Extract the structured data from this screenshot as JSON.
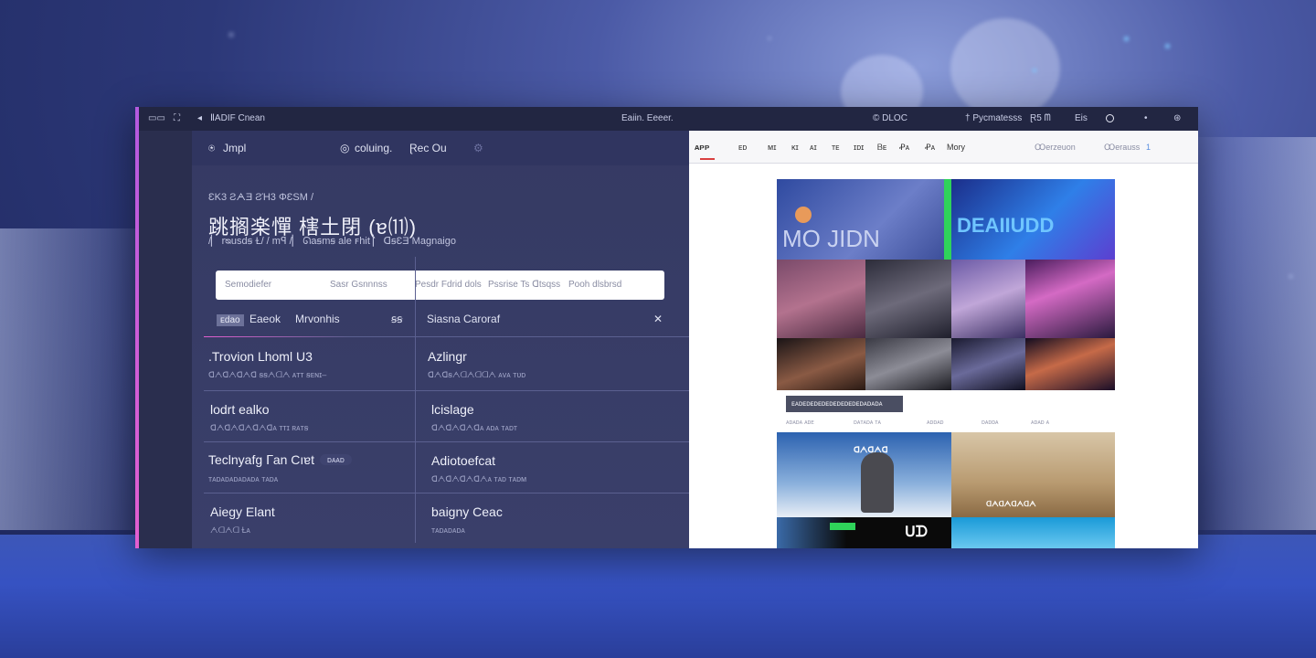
{
  "window": {
    "title": "ⅡADIF Cnean",
    "center_title": "Eaiin. Eeeer.",
    "status_right": [
      "© DLOC",
      "† Pycmatesss",
      "Ɽ5 ᗰ",
      "Eis"
    ]
  },
  "subbar": {
    "brand": "Jmpl",
    "search_label": "coluing.",
    "action": "Ɽec Ou"
  },
  "hero": {
    "breadcrumb": "ƐK3 ƧᗅƎ ƧΉ3 ΦƐSM /",
    "title": "跳搁楽憚 㮫土閉 (ɐ⑾)",
    "subtitle": "/▏ rᴓusdꞩ Ɫ/ /  mꟼ /▏ ᘏaꞩmꞩ ale ꜰhit ▏ ᗡꞩƐƎ Magnaigo"
  },
  "search": {
    "placeholder": "Semodiefer",
    "hints": [
      "Sasr Gsnnnss",
      "Pesdr Fdrid dols",
      "Pssrise Ts ᗡtsqss",
      "Pooh dlsbrsd"
    ]
  },
  "filters": {
    "chip": "ᴇdao",
    "left_a": "Eaeok",
    "left_b": "Mrvonhis",
    "left_x": "ꞩꞩ",
    "right_a": "Siasna Caroraf",
    "right_x": "✕"
  },
  "rows": [
    {
      "left_title": ".Trovion Lhoml U3",
      "left_sub": "ᗡᗅᗡᗅᗡᗅᗡ ꞩꞩᗅᗡᗅ  ᴀᴛᴛ  ꞩᴇɴɪ–",
      "right_title": "Azlingr",
      "right_sub": "ᗡᗅᗡꞩᗅᗡᗅᗡᗡᗅ  ᴀᴠᴀ  ᴛᴜᴅ"
    },
    {
      "left_title": "lodrt ealko",
      "left_sub": "ᗡᗅᗡᗅᗡᗅᗡᗅᗡᴀ  ᴛᴛɪ  ʀᴀᴛꞩ",
      "right_title": "lcislage",
      "right_sub": "ᗡᗅᗡᗅᗡᗅᗡᴀ  ᴀᴅᴀ  ᴛᴀᴅᴛ"
    },
    {
      "left_title": "Teclnyafg ᒥan Cıɐt",
      "left_pill": "ᴅᴀᴀᴅ",
      "left_sub": "ᴛᴀᴅᴀᴅᴀᴅᴀᴅᴀᴅᴀ  ᴛᴀᴅᴀ",
      "right_title": "Adiotoefcat",
      "right_sub": "ᗡᗅᗡᗅᗡᗅᗡᗅᴀ  ᴛᴀᴅ  ᴛᴀᴅᴍ"
    },
    {
      "left_title": "Aiegy Elant",
      "left_sub": "ᗅᗡᗅᗡ  Ɫᴀ",
      "right_title": "baigny Ceac",
      "right_sub": "ᴛᴀᴅᴀᴅᴀᴅᴀ"
    }
  ],
  "browser": {
    "nav": [
      "ᴀᴘᴘ",
      "ᴇᴅ",
      "ᴍɪ",
      "ᴋɪ",
      "ᴀɪ",
      "ᴛᴇ",
      "ɪᴅɪ",
      "Ᏼᴇ",
      "Ꝓᴀ",
      "Ꝓᴀ",
      "Mory"
    ],
    "nav_right": [
      "Ꝏerzeuon",
      "Ꝏerauss",
      "1"
    ],
    "tiles": [
      {
        "label": "MO JIDN",
        "color": "#3f5aa8"
      },
      {
        "label": "DEAIIUDD",
        "color": "#2f7fe8"
      }
    ],
    "caption": "ᴇᴀᴅᴇᴅᴇᴅᴇᴅᴇᴅᴇᴅᴇᴅᴇᴅᴇᴅᴀᴅᴀᴅᴀ",
    "meta": [
      "ᴀᴅᴀᴅᴀ ᴀᴅᴇ",
      "ᴅᴀᴛᴀᴅᴀ ᴛᴀ",
      "ᴀᴅᴅᴀᴅ",
      "ᴅᴀᴅᴅᴀ",
      "ᴀᴅᴀᴅ ᴀ"
    ],
    "tiles2": [
      {
        "label": "ᗡᗅᗡᗅᗡ",
        "color": "#2e5ca0"
      },
      {
        "label": "ᗡᗅᗡᗅᗡᗅᗡᗅ",
        "color": "#a98860"
      },
      {
        "label": "ᑌᗪ",
        "color": "#0a0a0a"
      }
    ]
  },
  "colors": {
    "accent": "#e35fd0",
    "panel": "#353a63",
    "background": "#2c3878"
  }
}
